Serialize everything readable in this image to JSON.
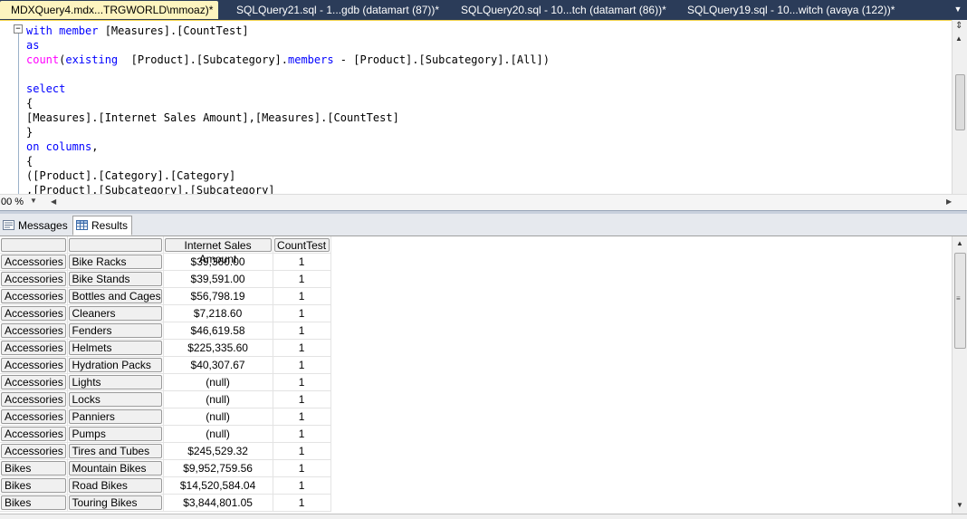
{
  "tabs": [
    {
      "label": "MDXQuery4.mdx...TRGWORLD\\mmoaz)*",
      "active": true
    },
    {
      "label": "SQLQuery21.sql - 1...gdb (datamart (87))*",
      "active": false
    },
    {
      "label": "SQLQuery20.sql - 10...tch (datamart (86))*",
      "active": false
    },
    {
      "label": "SQLQuery19.sql - 10...witch (avaya (122))*",
      "active": false
    }
  ],
  "editor": {
    "collapse_glyph": "−",
    "lines": [
      "with member [Measures].[CountTest]",
      "as",
      "count(existing  [Product].[Subcategory].members - [Product].[Subcategory].[All])",
      "",
      "select",
      "{",
      "[Measures].[Internet Sales Amount],[Measures].[CountTest]",
      "}",
      "on columns,",
      "{",
      "([Product].[Category].[Category]",
      ",[Product].[Subcategory].[Subcategory]"
    ]
  },
  "zoom": {
    "value": "00 %"
  },
  "results_tabs": {
    "messages": "Messages",
    "results": "Results"
  },
  "grid": {
    "headers": [
      "",
      "",
      "Internet Sales Amount",
      "CountTest"
    ],
    "rows": [
      [
        "Accessories",
        "Bike Racks",
        "$39,360.00",
        "1"
      ],
      [
        "Accessories",
        "Bike Stands",
        "$39,591.00",
        "1"
      ],
      [
        "Accessories",
        "Bottles and Cages",
        "$56,798.19",
        "1"
      ],
      [
        "Accessories",
        "Cleaners",
        "$7,218.60",
        "1"
      ],
      [
        "Accessories",
        "Fenders",
        "$46,619.58",
        "1"
      ],
      [
        "Accessories",
        "Helmets",
        "$225,335.60",
        "1"
      ],
      [
        "Accessories",
        "Hydration Packs",
        "$40,307.67",
        "1"
      ],
      [
        "Accessories",
        "Lights",
        "(null)",
        "1"
      ],
      [
        "Accessories",
        "Locks",
        "(null)",
        "1"
      ],
      [
        "Accessories",
        "Panniers",
        "(null)",
        "1"
      ],
      [
        "Accessories",
        "Pumps",
        "(null)",
        "1"
      ],
      [
        "Accessories",
        "Tires and Tubes",
        "$245,529.32",
        "1"
      ],
      [
        "Bikes",
        "Mountain Bikes",
        "$9,952,759.56",
        "1"
      ],
      [
        "Bikes",
        "Road Bikes",
        "$14,520,584.04",
        "1"
      ],
      [
        "Bikes",
        "Touring Bikes",
        "$3,844,801.05",
        "1"
      ]
    ]
  },
  "colors": {
    "tabbar": "#2b3c59",
    "active_tab": "#fdf4bf",
    "keyword": "#0000ff",
    "function": "#ff00ff"
  }
}
